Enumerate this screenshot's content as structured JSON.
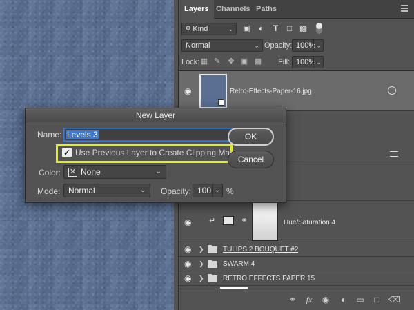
{
  "panel": {
    "tabs": [
      "Layers",
      "Channels",
      "Paths"
    ],
    "filter": {
      "label": "Kind"
    },
    "blend_mode": "Normal",
    "opacity_label": "Opacity:",
    "opacity_value": "100%",
    "lock_label": "Lock:",
    "fill_label": "Fill:",
    "fill_value": "100%",
    "layers": [
      {
        "name": "Retro-Effects-Paper-16.jpg",
        "selected": true
      },
      {
        "name": "Hue/Saturation 4"
      },
      {
        "name": "TULIPS 2 BOUQUET #2"
      },
      {
        "name": "SWARM 4"
      },
      {
        "name": "RETRO EFFECTS PAPER 15"
      }
    ],
    "bottom_icons": [
      "link-icon",
      "fx-icon",
      "mask-icon",
      "adjustment-icon",
      "folder-icon",
      "new-layer-icon",
      "trash-icon"
    ],
    "fx_label": "fx"
  },
  "dialog": {
    "title": "New Layer",
    "name_label": "Name:",
    "name_value": "Levels 3",
    "clip_label": "Use Previous Layer to Create Clipping Mask",
    "clip_checked": true,
    "color_label": "Color:",
    "color_value": "None",
    "mode_label": "Mode:",
    "mode_value": "Normal",
    "opacity_label": "Opacity:",
    "opacity_value": "100",
    "opacity_unit": "%",
    "ok_label": "OK",
    "cancel_label": "Cancel"
  },
  "colors": {
    "highlight": "#e1ef1a",
    "selection": "#3c78d8",
    "panel_bg": "#535353",
    "canvas": "#5a6f92"
  }
}
